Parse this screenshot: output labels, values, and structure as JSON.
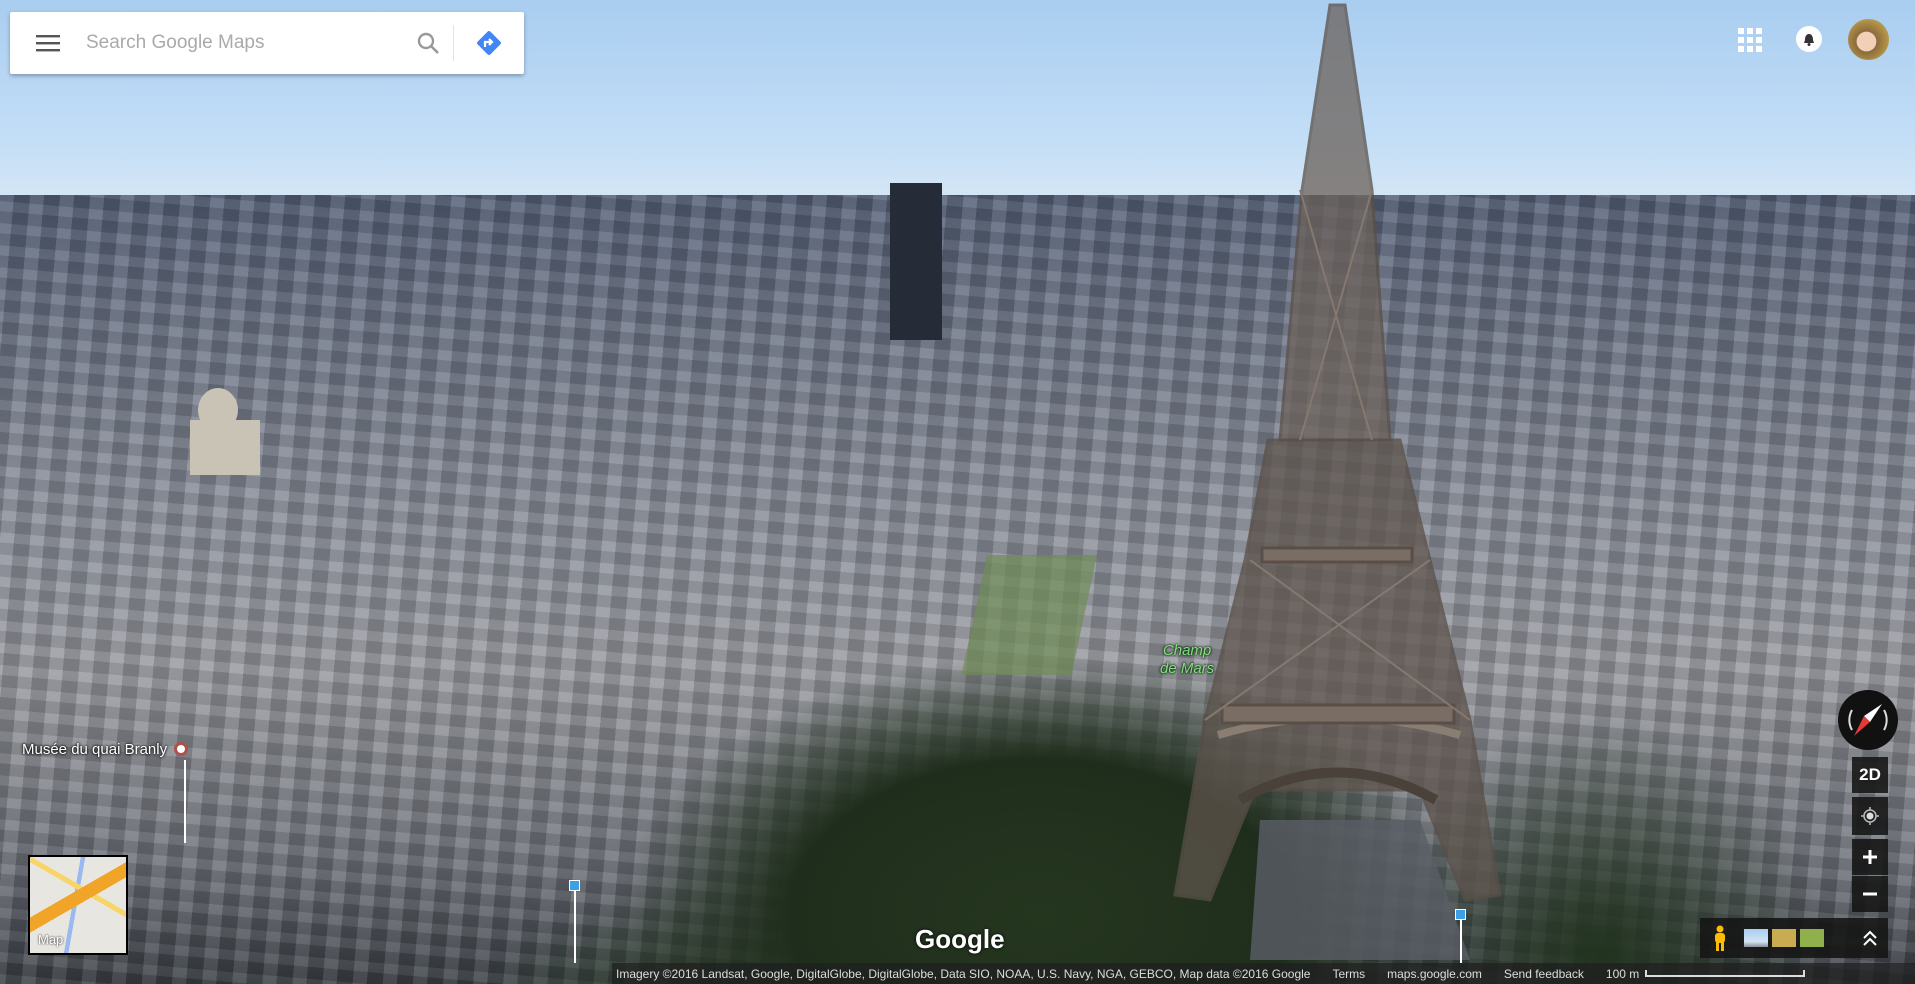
{
  "search": {
    "placeholder": "Search Google Maps"
  },
  "icons": {
    "menu": "hamburger-menu-icon",
    "search": "search-icon",
    "directions": "directions-icon",
    "apps": "apps-grid-icon",
    "notifications": "bell-icon",
    "compass": "compass-icon",
    "locate": "my-location-icon",
    "zoom_in": "plus-icon",
    "zoom_out": "minus-icon",
    "pegman": "pegman-icon",
    "expand": "chevron-double-up-icon"
  },
  "colors": {
    "accent": "#4285f4",
    "place_label_park": "#7fe07b",
    "pegman": "#fbbc05"
  },
  "map_labels": {
    "museum": "Musée du quai Branly",
    "park_line1": "Champ",
    "park_line2": "de Mars"
  },
  "logo": "Google",
  "map_toggle": {
    "label": "Map"
  },
  "controls": {
    "view_toggle": "2D"
  },
  "footer": {
    "imagery": "Imagery ©2016 Landsat, Google, DigitalGlobe, DigitalGlobe, Data SIO, NOAA, U.S. Navy, NGA, GEBCO, Map data ©2016 Google",
    "terms": "Terms",
    "site": "maps.google.com",
    "feedback": "Send feedback",
    "scale": "100 m"
  }
}
